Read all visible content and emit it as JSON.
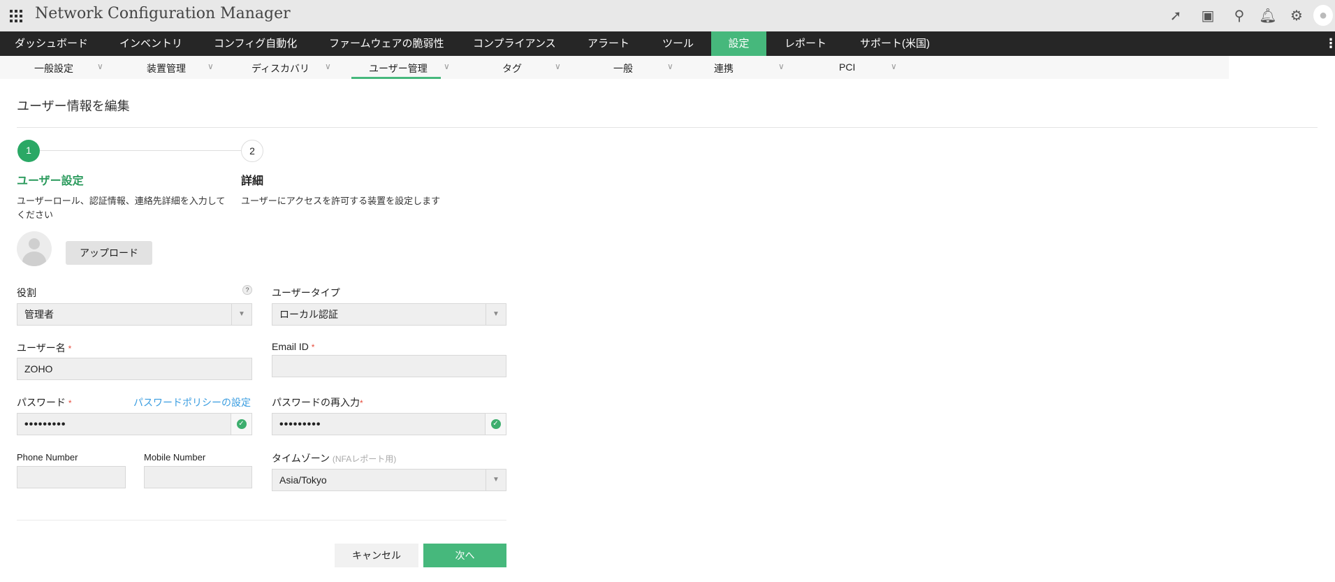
{
  "app": {
    "title": "Network Configuration Manager"
  },
  "main_nav": [
    {
      "label": "ダッシュボード"
    },
    {
      "label": "インベントリ"
    },
    {
      "label": "コンフィグ自動化"
    },
    {
      "label": "ファームウェアの脆弱性"
    },
    {
      "label": "コンプライアンス"
    },
    {
      "label": "アラート"
    },
    {
      "label": "ツール"
    },
    {
      "label": "設定",
      "active": true
    },
    {
      "label": "レポート"
    },
    {
      "label": "サポート(米国)"
    }
  ],
  "sub_nav": [
    {
      "label": "一般設定"
    },
    {
      "label": "装置管理"
    },
    {
      "label": "ディスカバリ"
    },
    {
      "label": "ユーザー管理",
      "active": true
    },
    {
      "label": "タグ"
    },
    {
      "label": "一般"
    },
    {
      "label": "連携"
    },
    {
      "label": "PCI"
    }
  ],
  "page": {
    "title": "ユーザー情報を編集"
  },
  "steps": [
    {
      "number": "1",
      "title": "ユーザー設定",
      "desc_line1": "ユーザーロール、認証情報、連絡先詳細を入力して",
      "desc_line2": "ください"
    },
    {
      "number": "2",
      "title": "詳細",
      "desc_line1": "ユーザーにアクセスを許可する装置を設定します"
    }
  ],
  "form": {
    "upload_label": "アップロード",
    "role": {
      "label": "役割",
      "help": "?",
      "value": "管理者"
    },
    "user_type": {
      "label": "ユーザータイプ",
      "value": "ローカル認証"
    },
    "username": {
      "label": "ユーザー名",
      "required": "*",
      "value": "ZOHO"
    },
    "email": {
      "label": "Email ID",
      "required": "*",
      "value": ""
    },
    "password": {
      "label": "パスワード",
      "required": "*",
      "policy_link": "パスワードポリシーの設定",
      "value": "•••••••••"
    },
    "password_confirm": {
      "label": "パスワードの再入力",
      "required": "*",
      "value": "•••••••••"
    },
    "phone": {
      "label": "Phone Number",
      "value": ""
    },
    "mobile": {
      "label": "Mobile Number",
      "value": ""
    },
    "timezone": {
      "label": "タイムゾーン",
      "note": "(NFAレポート用)",
      "value": "Asia/Tokyo"
    }
  },
  "actions": {
    "cancel": "キャンセル",
    "next": "次へ"
  },
  "colors": {
    "accent": "#46b87c",
    "nav_bg": "#262626",
    "link": "#3a9de0"
  }
}
